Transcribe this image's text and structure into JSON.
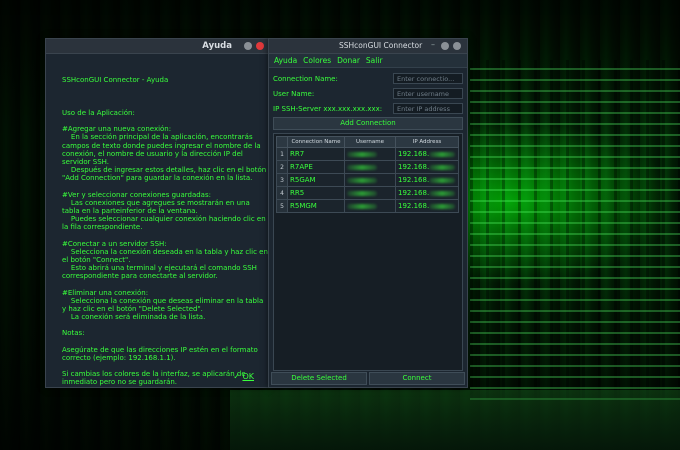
{
  "help_window": {
    "title": "Ayuda",
    "heading": "SSHconGUI Connector - Ayuda",
    "lines": [
      "Uso de la Aplicación:",
      "",
      "#Agregar una nueva conexión:",
      "    En la sección principal de la aplicación, encontrarás campos de texto donde puedes ingresar el nombre de la conexión, el nombre de usuario y la dirección IP del servidor SSH.",
      "    Después de ingresar estos detalles, haz clic en el botón \"Add Connection\" para guardar la conexión en la lista.",
      "",
      "#Ver y seleccionar conexiones guardadas:",
      "    Las conexiones que agregues se mostrarán en una tabla en la parteinferior de la ventana.",
      "    Puedes seleccionar cualquier conexión haciendo clic en la fila correspondiente.",
      "",
      "#Conectar a un servidor SSH:",
      "    Selecciona la conexión deseada en la tabla y haz clic en el botón \"Connect\".",
      "    Esto abrirá una terminal y ejecutará el comando SSH correspondiente para conectarte al servidor.",
      "",
      "#Eliminar una conexión:",
      "    Selecciona la conexión que deseas eliminar en la tabla y haz clic en el botón \"Delete Selected\".",
      "    La conexión será eliminada de la lista.",
      "",
      "Notas:",
      "",
      "Asegúrate de que las direcciones IP estén en el formato correcto (ejemplo: 192.168.1.1).",
      "",
      "Si cambias los colores de la interfaz, se aplicarán de inmediato pero no se guardarán."
    ],
    "ok_prefix": "✓ ",
    "ok_label": "OK"
  },
  "main_window": {
    "title": "SSHconGUI Connector",
    "menu": [
      "Ayuda",
      "Colores",
      "Donar",
      "Salir"
    ],
    "form": {
      "name_label": "Connection Name:",
      "name_placeholder": "Enter connectio...",
      "user_label": "User Name:",
      "user_placeholder": "Enter username",
      "ip_label": "IP SSH-Server xxx.xxx.xxx.xxx:",
      "ip_placeholder": "Enter IP address"
    },
    "add_button": "Add Connection",
    "table": {
      "headers": [
        "Connection Name",
        "Username",
        "IP Address"
      ],
      "rows": [
        {
          "idx": "1",
          "name": "RR7",
          "ip": "192.168."
        },
        {
          "idx": "2",
          "name": "R7APE",
          "ip": "192.168."
        },
        {
          "idx": "3",
          "name": "R5GAM",
          "ip": "192.168."
        },
        {
          "idx": "4",
          "name": "RR5",
          "ip": "192.168."
        },
        {
          "idx": "5",
          "name": "R5MGM",
          "ip": "192.168."
        }
      ]
    },
    "delete_button": "Delete Selected",
    "connect_button": "Connect"
  },
  "colors": {
    "accent": "#39ff3c",
    "window_bg": "#1c2630",
    "close": "#e0393b"
  }
}
